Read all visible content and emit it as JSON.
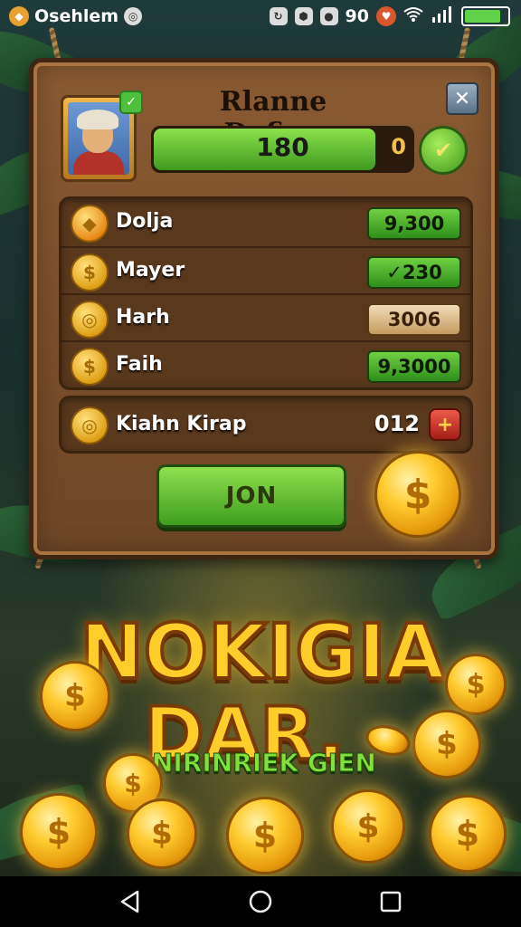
{
  "status_bar": {
    "app_name": "Osehlem",
    "time": "90",
    "indicators": [
      "wifi-icon",
      "signal-icon"
    ],
    "battery_level": 0.85
  },
  "profile": {
    "name": "Rlanne Dofian",
    "xp_value": "180",
    "xp_max": "0",
    "xp_fill": 0.86,
    "close_label": "✕"
  },
  "resources": [
    {
      "label": "Dolja",
      "value": "9,300",
      "style": "green"
    },
    {
      "label": "Mayer",
      "value": "✓230",
      "style": "green"
    },
    {
      "label": "Harh",
      "value": "3006",
      "style": "brown"
    },
    {
      "label": "Faih",
      "value": "9,3000",
      "style": "green"
    }
  ],
  "bonus": {
    "label": "Kiahn Kirap",
    "value": "012",
    "plus_label": "+"
  },
  "join_button": "JON",
  "promo": {
    "title_line1": "NOKIGIA",
    "title_line2": "DAR.",
    "subtitle": "NIRINRIEK GIEN"
  },
  "coin_symbol": "$",
  "colors": {
    "board": "#7a4e2a",
    "accent_green": "#4cbf2a",
    "coin_gold": "#ffcb2e"
  }
}
